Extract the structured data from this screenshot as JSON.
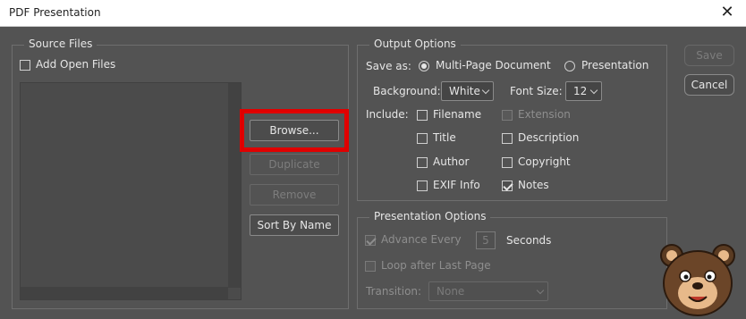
{
  "window": {
    "title": "PDF Presentation",
    "close_glyph": "✕"
  },
  "source_files": {
    "legend": "Source Files",
    "add_open_files": {
      "label": "Add Open Files",
      "checked": false
    },
    "buttons": {
      "browse": "Browse...",
      "duplicate": "Duplicate",
      "remove": "Remove",
      "sort_by_name": "Sort By Name"
    }
  },
  "output_options": {
    "legend": "Output Options",
    "save_as_label": "Save as:",
    "save_as_options": [
      {
        "label": "Multi-Page Document",
        "selected": true
      },
      {
        "label": "Presentation",
        "selected": false
      }
    ],
    "background_label": "Background:",
    "background_value": "White",
    "font_size_label": "Font Size:",
    "font_size_value": "12",
    "include_label": "Include:",
    "include": [
      {
        "label": "Filename",
        "checked": false,
        "enabled": true
      },
      {
        "label": "Extension",
        "checked": false,
        "enabled": false
      },
      {
        "label": "Title",
        "checked": false,
        "enabled": true
      },
      {
        "label": "Description",
        "checked": false,
        "enabled": true
      },
      {
        "label": "Author",
        "checked": false,
        "enabled": true
      },
      {
        "label": "Copyright",
        "checked": false,
        "enabled": true
      },
      {
        "label": "EXIF Info",
        "checked": false,
        "enabled": true
      },
      {
        "label": "Notes",
        "checked": true,
        "enabled": true
      }
    ]
  },
  "presentation_options": {
    "legend": "Presentation Options",
    "advance_every": {
      "label": "Advance Every",
      "checked": true,
      "enabled": false
    },
    "seconds_value": "5",
    "seconds_label": "Seconds",
    "loop": {
      "label": "Loop after Last Page",
      "checked": false,
      "enabled": false
    },
    "transition_label": "Transition:",
    "transition_value": "None"
  },
  "actions": {
    "save": "Save",
    "cancel": "Cancel"
  },
  "colors": {
    "dialog_bg": "#535353",
    "highlight": "#e00000"
  }
}
